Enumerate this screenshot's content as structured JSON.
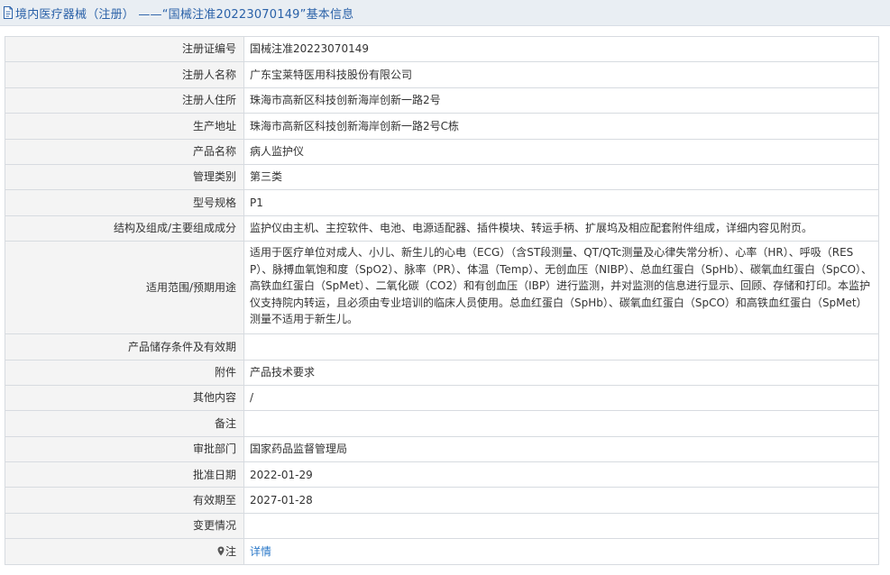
{
  "header": {
    "title": "境内医疗器械（注册） ——“国械注准20223070149”基本信息",
    "icon": "document-icon",
    "color": "#2a61a8"
  },
  "rows": [
    {
      "label": "注册证编号",
      "value": "国械注准20223070149"
    },
    {
      "label": "注册人名称",
      "value": "广东宝莱特医用科技股份有限公司"
    },
    {
      "label": "注册人住所",
      "value": "珠海市高新区科技创新海岸创新一路2号"
    },
    {
      "label": "生产地址",
      "value": "珠海市高新区科技创新海岸创新一路2号C栋"
    },
    {
      "label": "产品名称",
      "value": "病人监护仪"
    },
    {
      "label": "管理类别",
      "value": "第三类"
    },
    {
      "label": "型号规格",
      "value": "P1"
    },
    {
      "label": "结构及组成/主要组成成分",
      "value": "监护仪由主机、主控软件、电池、电源适配器、插件模块、转运手柄、扩展坞及相应配套附件组成，详细内容见附页。"
    },
    {
      "label": "适用范围/预期用途",
      "value": "适用于医疗单位对成人、小儿、新生儿的心电（ECG）（含ST段测量、QT/QTc测量及心律失常分析）、心率（HR）、呼吸（RESP）、脉搏血氧饱和度（SpO2）、脉率（PR）、体温（Temp）、无创血压（NIBP）、总血红蛋白（SpHb）、碳氧血红蛋白（SpCO）、高铁血红蛋白（SpMet）、二氧化碳（CO2）和有创血压（IBP）进行监测，并对监测的信息进行显示、回顾、存储和打印。本监护仪支持院内转运，且必须由专业培训的临床人员使用。总血红蛋白（SpHb）、碳氧血红蛋白（SpCO）和高铁血红蛋白（SpMet）测量不适用于新生儿。"
    },
    {
      "label": "产品储存条件及有效期",
      "value": ""
    },
    {
      "label": "附件",
      "value": "产品技术要求"
    },
    {
      "label": "其他内容",
      "value": "/"
    },
    {
      "label": "备注",
      "value": ""
    },
    {
      "label": "审批部门",
      "value": "国家药品监督管理局"
    },
    {
      "label": "批准日期",
      "value": "2022-01-29"
    },
    {
      "label": "有效期至",
      "value": "2027-01-28"
    },
    {
      "label": "变更情况",
      "value": ""
    }
  ],
  "note_row": {
    "label": "注",
    "icon": "pin-icon",
    "link_text": "详情",
    "link_color": "#2a78c8"
  }
}
